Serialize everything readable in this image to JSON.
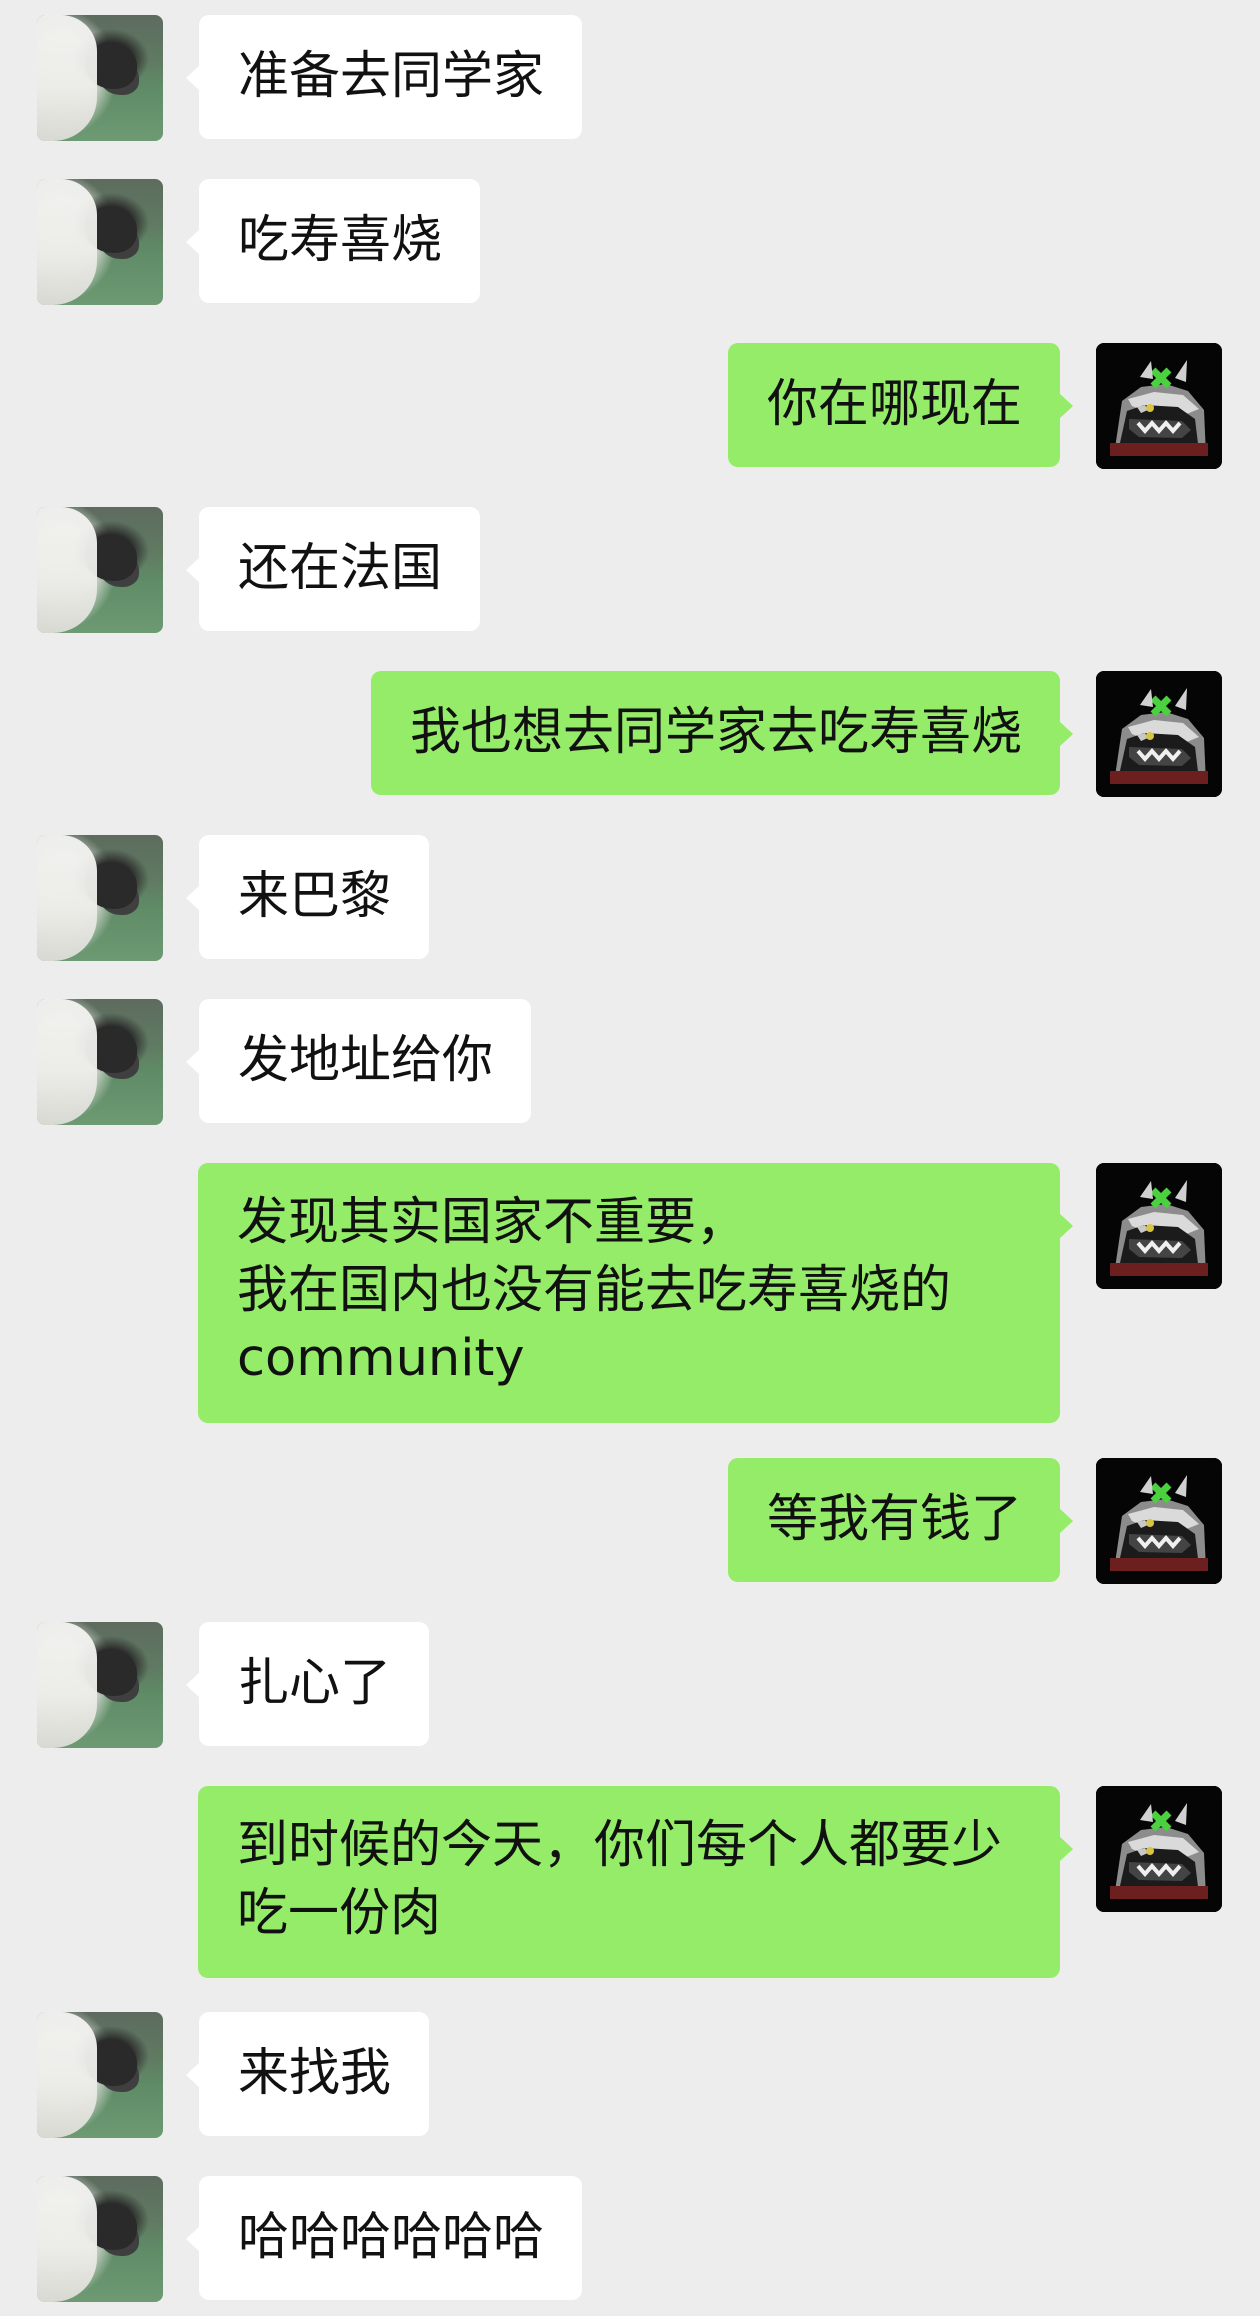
{
  "colors": {
    "background": "#ededed",
    "incoming_bubble": "#ffffff",
    "outgoing_bubble": "#95ec69",
    "text": "#111111"
  },
  "messages": [
    {
      "side": "in",
      "text": "准备去同学家"
    },
    {
      "side": "in",
      "text": "吃寿喜烧"
    },
    {
      "side": "out",
      "text": "你在哪现在"
    },
    {
      "side": "in",
      "text": "还在法国"
    },
    {
      "side": "out",
      "text": "我也想去同学家去吃寿喜烧"
    },
    {
      "side": "in",
      "text": "来巴黎"
    },
    {
      "side": "in",
      "text": "发地址给你"
    },
    {
      "side": "out",
      "text": "发现其实国家不重要，\n我在国内也没有能去吃寿喜烧的\ncommunity"
    },
    {
      "side": "out",
      "text": "等我有钱了"
    },
    {
      "side": "in",
      "text": "扎心了"
    },
    {
      "side": "out",
      "text": "到时候的今天，你们每个人都要少\n吃一份肉"
    },
    {
      "side": "in",
      "text": "来找我"
    },
    {
      "side": "in",
      "text": "哈哈哈哈哈哈"
    }
  ]
}
